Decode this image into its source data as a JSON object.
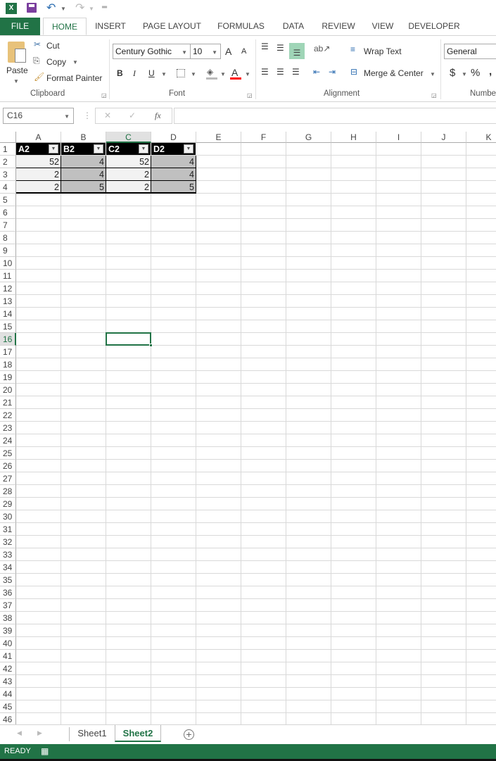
{
  "qat": {
    "icons": [
      "excel-icon",
      "save-icon",
      "undo-icon",
      "redo-icon",
      "customize-icon"
    ]
  },
  "tabs": [
    "FILE",
    "HOME",
    "INSERT",
    "PAGE LAYOUT",
    "FORMULAS",
    "DATA",
    "REVIEW",
    "VIEW",
    "DEVELOPER"
  ],
  "active_tab": "HOME",
  "clipboard": {
    "paste": "Paste",
    "cut": "Cut",
    "copy": "Copy",
    "format_painter": "Format Painter",
    "label": "Clipboard"
  },
  "font": {
    "name": "Century Gothic",
    "size": "10",
    "bold": "B",
    "italic": "I",
    "underline": "U",
    "grow": "A",
    "shrink": "A",
    "color_a": "A",
    "label": "Font",
    "font_color": "#ff0000"
  },
  "alignment": {
    "wrap": "Wrap Text",
    "merge": "Merge & Center",
    "label": "Alignment"
  },
  "number": {
    "format": "General",
    "currency": "$",
    "percent": "%",
    "comma": ",",
    "label": "Numbe"
  },
  "formula_bar": {
    "name_box": "C16",
    "fx": "fx",
    "value": ""
  },
  "columns": [
    "A",
    "B",
    "C",
    "D",
    "E",
    "F",
    "G",
    "H",
    "I",
    "J",
    "K"
  ],
  "selected_column": "C",
  "selected_row": 16,
  "active_cell": "C16",
  "row_count": 46,
  "table": {
    "headers": [
      "A2",
      "B2",
      "C2",
      "D2"
    ],
    "rows": [
      [
        "52",
        "4",
        "52",
        "4"
      ],
      [
        "2",
        "4",
        "2",
        "4"
      ],
      [
        "2",
        "5",
        "2",
        "5"
      ]
    ]
  },
  "sheets": [
    "Sheet1",
    "Sheet2"
  ],
  "active_sheet": "Sheet2",
  "status": "READY",
  "accent": "#217346"
}
